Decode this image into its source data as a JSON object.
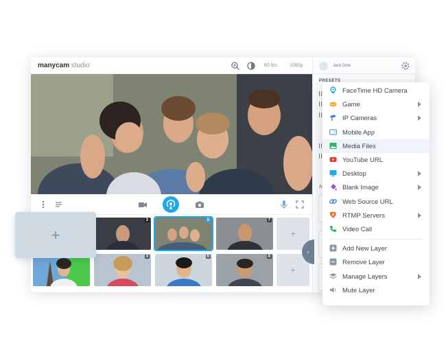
{
  "app": {
    "brand_main": "manycam",
    "brand_sub": " studio",
    "fps": "60 fps",
    "resolution": "1080p"
  },
  "panel": {
    "user_name": "Jack Dow",
    "presets_label": "PRESETS",
    "section_letter": "A"
  },
  "thumbnails": [
    {
      "number": "3",
      "selected": false
    },
    {
      "number": "5",
      "selected": true
    },
    {
      "number": "7",
      "selected": false
    },
    {
      "number": "4",
      "selected": false
    },
    {
      "number": "6",
      "selected": false
    },
    {
      "number": "8",
      "selected": false
    }
  ],
  "empty_tile": "+",
  "add_tile": "+",
  "menu": {
    "items": [
      {
        "label": "FaceTime HD Camera",
        "icon": "webcam-icon",
        "color": "#21a8e8",
        "submenu": false
      },
      {
        "label": "Game",
        "icon": "gamepad-icon",
        "color": "#f5a623",
        "submenu": true
      },
      {
        "label": "IP Cameras",
        "icon": "ip-camera-icon",
        "color": "#3b7dd8",
        "submenu": true
      },
      {
        "label": "Mobile App",
        "icon": "mobile-app-icon",
        "color": "#5b9bd5",
        "submenu": false
      },
      {
        "label": "Media Files",
        "icon": "image-icon",
        "color": "#2fb36b",
        "submenu": false,
        "highlighted": true
      },
      {
        "label": "YouTube URL",
        "icon": "youtube-icon",
        "color": "#e53935",
        "submenu": false
      },
      {
        "label": "Desktop",
        "icon": "monitor-icon",
        "color": "#21a8e8",
        "submenu": true
      },
      {
        "label": "Blank Image",
        "icon": "paint-bucket-icon",
        "color": "#8e5bd8",
        "submenu": true
      },
      {
        "label": "Web Source URL",
        "icon": "link-icon",
        "color": "#3b7dd8",
        "submenu": false
      },
      {
        "label": "RTMP Servers",
        "icon": "rtmp-icon",
        "color": "#f26b2a",
        "submenu": true
      },
      {
        "label": "Video Call",
        "icon": "phone-icon",
        "color": "#2fb36b",
        "submenu": false
      }
    ],
    "layer_items": [
      {
        "label": "Add New Layer",
        "icon": "add-layer-icon",
        "submenu": false
      },
      {
        "label": "Remove Layer",
        "icon": "remove-layer-icon",
        "submenu": false
      },
      {
        "label": "Manage Layers",
        "icon": "layers-icon",
        "submenu": true
      },
      {
        "label": "Mute Layer",
        "icon": "speaker-icon",
        "submenu": false
      }
    ]
  }
}
